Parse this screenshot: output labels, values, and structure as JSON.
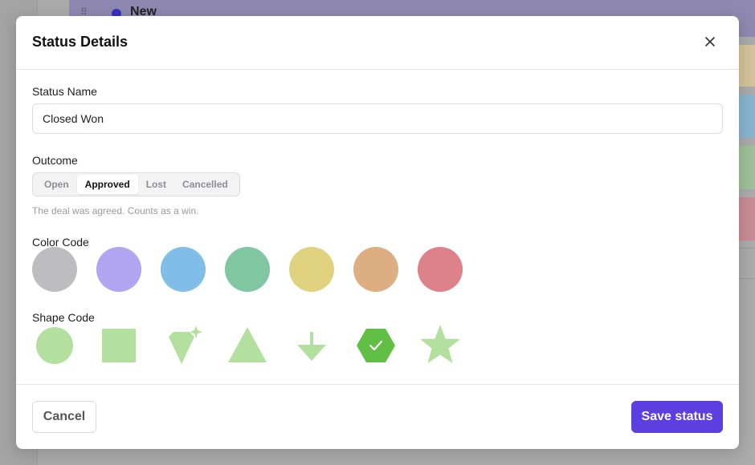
{
  "background": {
    "column_title": "New",
    "column_color": "#3c2ec4",
    "row_colors": [
      "#d3c49a",
      "#88b4ce",
      "#9fc19a",
      "#c88c94"
    ]
  },
  "modal": {
    "title": "Status Details",
    "status_name": {
      "label": "Status Name",
      "value": "Closed Won"
    },
    "outcome": {
      "label": "Outcome",
      "options": [
        "Open",
        "Approved",
        "Lost",
        "Cancelled"
      ],
      "selected": "Approved",
      "hint": "The deal was agreed. Counts as a win."
    },
    "color_code": {
      "label": "Color Code",
      "colors": [
        "#bdbdc0",
        "#b1a4f0",
        "#80bde8",
        "#80c6a0",
        "#e0d27e",
        "#dcae82",
        "#dc8288"
      ]
    },
    "shape_code": {
      "label": "Shape Code",
      "shapes": [
        "circle",
        "square",
        "diamond-sparkle",
        "triangle",
        "arrow-down",
        "hexagon",
        "star"
      ],
      "selected": "hexagon",
      "color": "#b3e09e",
      "selected_color": "#61bf45"
    },
    "footer": {
      "cancel_label": "Cancel",
      "save_label": "Save status"
    }
  }
}
